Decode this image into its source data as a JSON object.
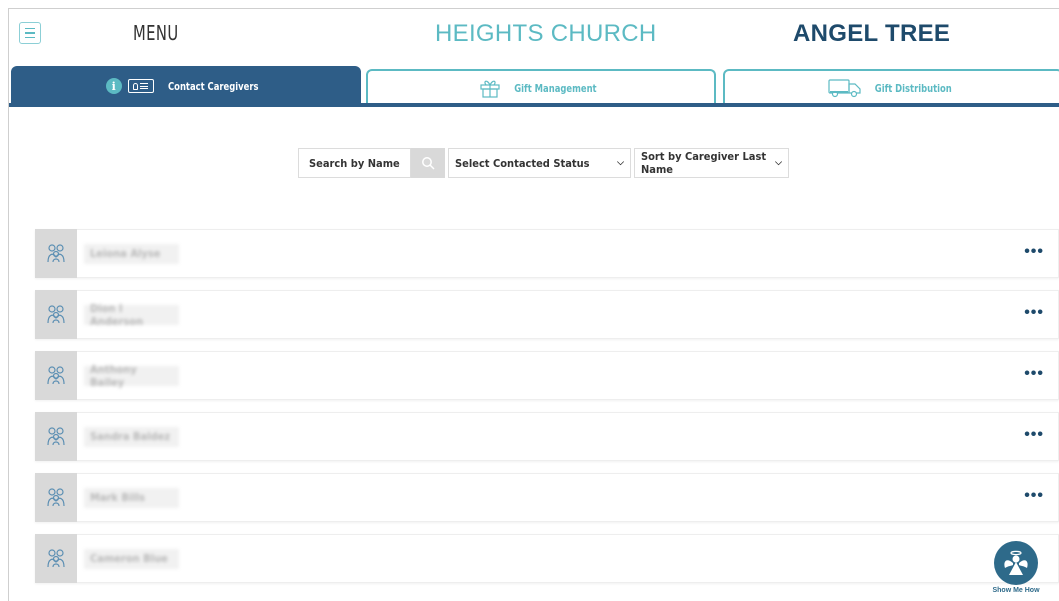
{
  "header": {
    "menu_label": "MENU",
    "church_name": "HEIGHTS CHURCH",
    "app_name": "ANGEL TREE"
  },
  "tabs": [
    {
      "label": "Contact Caregivers",
      "icon": "contact-card-icon",
      "active": true
    },
    {
      "label": "Gift Management",
      "icon": "gift-icon",
      "active": false
    },
    {
      "label": "Gift Distribution",
      "icon": "delivery-truck-icon",
      "active": false
    }
  ],
  "filters": {
    "search_placeholder": "Search by Name",
    "status_select": "Select Contacted Status",
    "sort_select": "Sort by Caregiver Last Name"
  },
  "caregivers": [
    {
      "name": "Leiona Alyse"
    },
    {
      "name": "Dion I Anderson"
    },
    {
      "name": "Anthony Bailey"
    },
    {
      "name": "Sandra Baldez"
    },
    {
      "name": "Mark Bills"
    },
    {
      "name": "Cameron Blue"
    }
  ],
  "help": {
    "label": "Show Me How"
  },
  "colors": {
    "primary": "#2e5d87",
    "accent": "#5cbac3",
    "title_dark": "#1e4a6b"
  }
}
